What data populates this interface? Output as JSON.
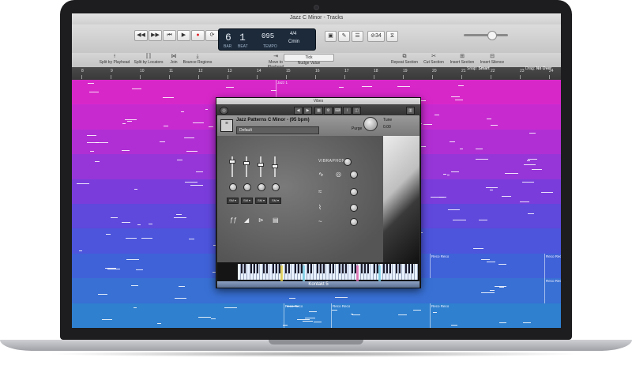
{
  "window": {
    "title": "Jazz C Minor - Tracks"
  },
  "transport": {
    "rewind": "◀◀",
    "forward": "▶▶",
    "to_start": "⏮",
    "play": "▶",
    "record": "●",
    "cycle": "⟳"
  },
  "lcd": {
    "bar": "6",
    "beat": "1",
    "bar_label": "BAR",
    "beat_label": "BEAT",
    "tempo": "095",
    "tempo_label": "TEMPO",
    "signature": "4/4",
    "key": "Cmin"
  },
  "extra_buttons": {
    "counter": "⊘34",
    "tuner": "⧖"
  },
  "tools": [
    {
      "name": "split-by-playhead",
      "label": "Split by Playhead",
      "icon": "⟊"
    },
    {
      "name": "split-by-locators",
      "label": "Split by Locators",
      "icon": "⟦⟧"
    },
    {
      "name": "join",
      "label": "Join",
      "icon": "⋈"
    },
    {
      "name": "bounce-regions",
      "label": "Bounce Regions",
      "icon": "⤓"
    },
    {
      "name": "move-to-playhead",
      "label": "Move to Playhead",
      "icon": "⇥"
    },
    {
      "name": "nudge-value",
      "label": "Nudge Value",
      "icon": ""
    },
    {
      "name": "repeat-section",
      "label": "Repeat Section",
      "icon": "⧉"
    },
    {
      "name": "cut-section",
      "label": "Cut Section",
      "icon": "✂"
    },
    {
      "name": "insert-section",
      "label": "Insert Section",
      "icon": "⊞"
    },
    {
      "name": "insert-silence",
      "label": "Insert Silence",
      "icon": "⊟"
    }
  ],
  "nudge": {
    "value": "Tick"
  },
  "snap": {
    "label": "Snap:",
    "value": "Smart"
  },
  "drag": {
    "label": "Drag:",
    "value": "No Over"
  },
  "ruler": [
    "8",
    "9",
    "10",
    "11",
    "12",
    "13",
    "14",
    "15",
    "16",
    "17",
    "18",
    "19",
    "20",
    "21",
    "22",
    "23",
    "24"
  ],
  "tracks": [
    {
      "color": "#d827c9",
      "label": "Jazz 1"
    },
    {
      "color": "#c72bd0",
      "label": ""
    },
    {
      "color": "#b02fd4",
      "label": ""
    },
    {
      "color": "#9636d8",
      "label": ""
    },
    {
      "color": "#7a3ddc",
      "label": ""
    },
    {
      "color": "#5f48dc",
      "label": ""
    },
    {
      "color": "#4c55dc",
      "label": ""
    },
    {
      "color": "#3f62d8",
      "label": "Reco Reco"
    },
    {
      "color": "#3870d4",
      "label": "Reco Reco"
    },
    {
      "color": "#2f80cf",
      "label": "Reco Reco"
    }
  ],
  "kontakt": {
    "window_title": "Vibes",
    "preset": "Jazz Patterns C Minor - (95 bpm)",
    "default_label": "Default",
    "tune_label": "Tune",
    "tune_value": "0.00",
    "purge": "Purge",
    "logo_text": "VIBRAPHONE",
    "sm_labels": [
      "SM ▾",
      "SM ▾",
      "SM ▾",
      "SM ▾"
    ],
    "footer": "Kontakt 5"
  }
}
